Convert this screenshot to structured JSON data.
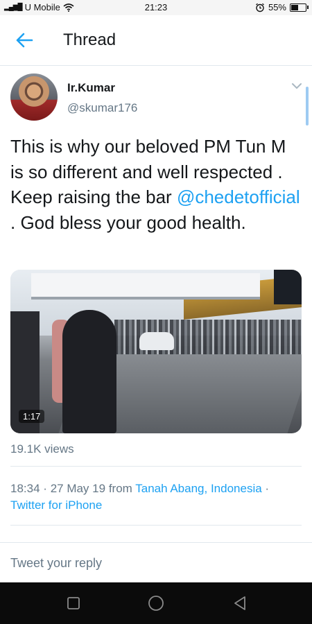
{
  "status_bar": {
    "carrier": "U Mobile",
    "time": "21:23",
    "battery": "55%",
    "battery_level": 0.55,
    "icons": [
      "signal-icon",
      "wifi-icon",
      "alarm-icon",
      "battery-icon"
    ]
  },
  "header": {
    "title": "Thread",
    "back_icon": "arrow-left-icon"
  },
  "tweet": {
    "author_name": "Ir.Kumar",
    "author_handle": "@skumar176",
    "text_before": "This is why our beloved PM Tun M is so different and well respected . Keep raising the bar ",
    "mention": "@chedetofficial",
    "text_after": " . God bless your good health.",
    "video_duration": "1:17",
    "views": "19.1K views",
    "time": "18:34",
    "date": "27 May 19",
    "from_label": "from",
    "location": "Tanah Abang, Indonesia",
    "source": "Twitter for iPhone"
  },
  "reply": {
    "placeholder": "Tweet your reply"
  },
  "colors": {
    "accent": "#1da1f2",
    "secondary_text": "#657786",
    "primary_text": "#14171a",
    "divider": "#e1e8ed"
  },
  "android_nav": {
    "icons": [
      "recent-apps-icon",
      "home-icon",
      "back-triangle-icon"
    ]
  }
}
